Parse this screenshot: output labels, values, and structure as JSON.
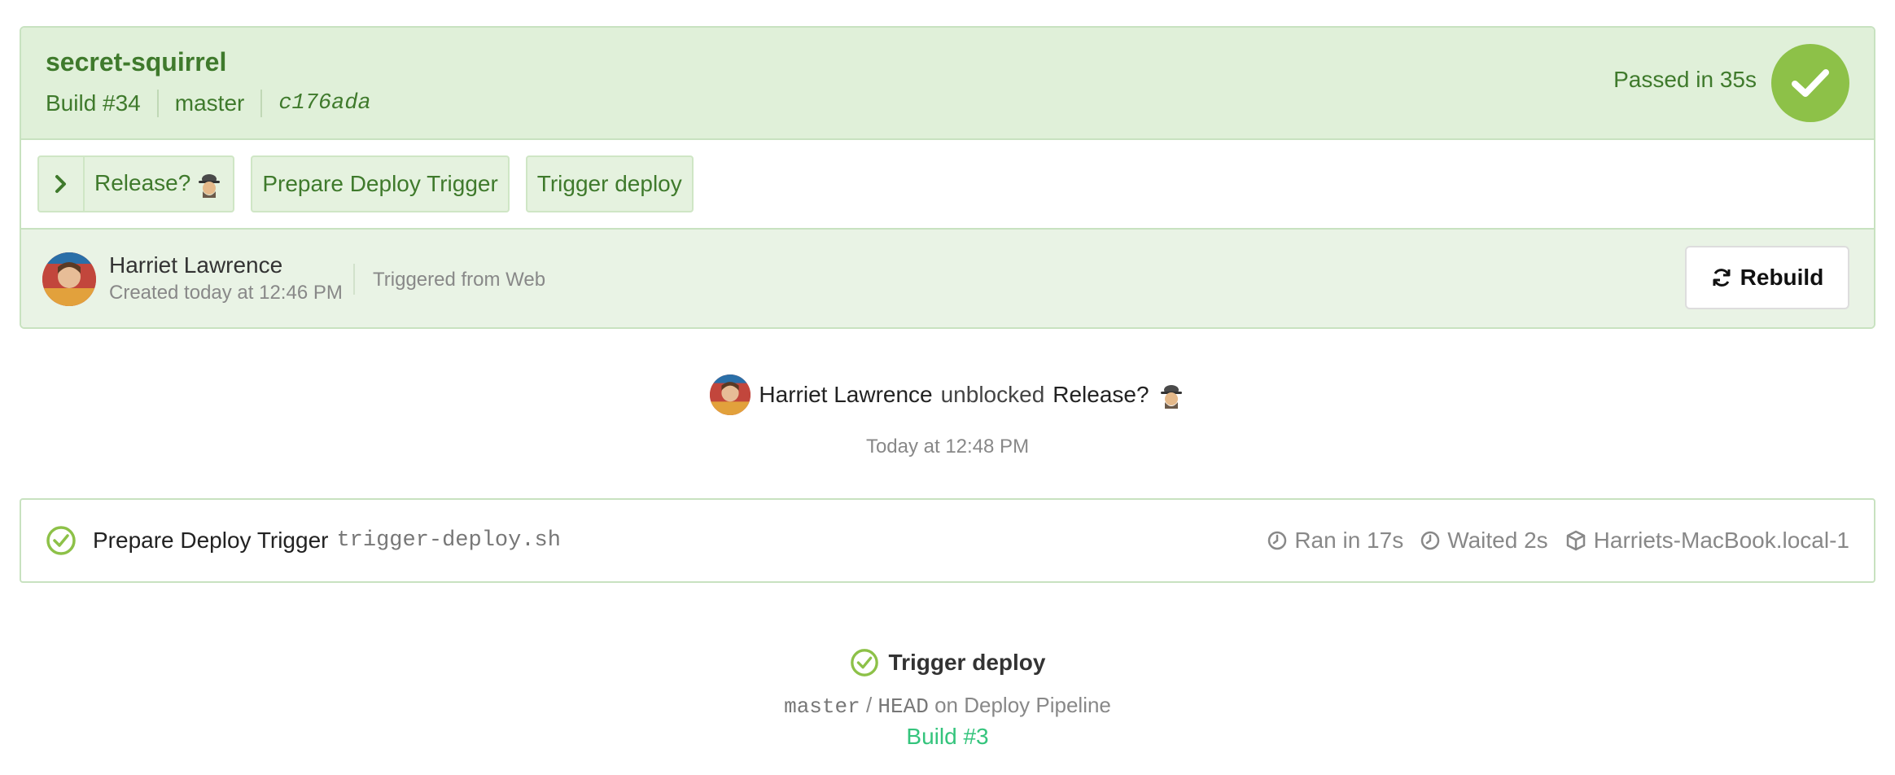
{
  "build": {
    "project": "secret-squirrel",
    "number": "Build #34",
    "branch": "master",
    "commit": "c176ada",
    "status_text": "Passed in 35s",
    "status_color": "#8dc148"
  },
  "jobs": [
    {
      "label": "Release?",
      "type": "block",
      "icon": "chevron-right-icon",
      "emoji": "detective-emoji"
    },
    {
      "label": "Prepare Deploy Trigger",
      "type": "command"
    },
    {
      "label": "Trigger deploy",
      "type": "trigger"
    }
  ],
  "creator": {
    "name": "Harriet Lawrence",
    "created": "Created today at 12:46 PM",
    "source": "Triggered from Web",
    "rebuild_label": "Rebuild"
  },
  "unblock_event": {
    "user": "Harriet Lawrence",
    "verb": "unblocked",
    "step": "Release?",
    "time": "Today at 12:48 PM"
  },
  "step": {
    "name": "Prepare Deploy Trigger",
    "command": "trigger-deploy.sh",
    "ran": "Ran in 17s",
    "waited": "Waited 2s",
    "agent": "Harriets-MacBook.local-1"
  },
  "trigger": {
    "title": "Trigger deploy",
    "branch": "master",
    "separator": "/",
    "commit": "HEAD",
    "pipeline": "on Deploy Pipeline",
    "build_link": "Build #3",
    "link_color": "#34c47c"
  }
}
